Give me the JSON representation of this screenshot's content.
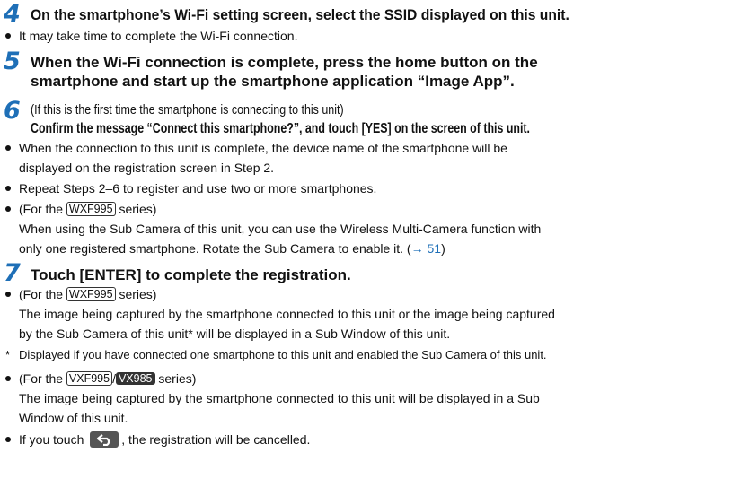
{
  "step4": {
    "number": "4",
    "text": "On the smartphone’s Wi-Fi setting screen, select the SSID displayed on this unit.",
    "bullet": "It may take time to complete the Wi-Fi connection."
  },
  "step5": {
    "number": "5",
    "line1": "When the Wi-Fi connection is complete, press the home button on the",
    "line2": "smartphone and start up the smartphone application “Image App”."
  },
  "step6": {
    "number": "6",
    "intro": "(If this is the first time the smartphone is connecting to this unit)",
    "bold": "Confirm the message “Connect this smartphone?”, and touch [YES] on the screen of this unit.",
    "bullet1_line1": "When the connection to this unit is complete, the device name of the smartphone will be",
    "bullet1_line2": "displayed on the registration screen in Step 2.",
    "bullet2": "Repeat Steps 2–6 to register and use two or more smartphones.",
    "bullet3_prefix": "(For the",
    "bullet3_badge": "WXF995",
    "bullet3_suffix": "series)",
    "bullet3_line2": "When using the Sub Camera of this unit, you can use the Wireless Multi-Camera function with",
    "bullet3_line3_text": "only one registered smartphone. Rotate the Sub Camera to enable it. (",
    "bullet3_link": "→ 51",
    "bullet3_close": ")"
  },
  "step7": {
    "number": "7",
    "text": "Touch [ENTER] to complete the registration.",
    "bullet1_prefix": "(For the",
    "bullet1_badge": "WXF995",
    "bullet1_suffix": "series)",
    "bullet1_line2": "The image being captured by the smartphone connected to this unit or the image being captured",
    "bullet1_line3": "by the Sub Camera of this unit* will be displayed in a Sub Window of this unit.",
    "footnote_star": "*",
    "footnote": "Displayed if you have connected one smartphone to this unit and enabled the Sub Camera of this unit.",
    "bullet2_prefix": "(For the",
    "bullet2_badge1": "VXF995",
    "bullet2_sep": "/",
    "bullet2_badge2": "VX985",
    "bullet2_suffix": "series)",
    "bullet2_line2": "The image being captured by the smartphone connected to this unit will be displayed in a Sub",
    "bullet2_line3": "Window of this unit.",
    "bullet3_prefix": "If you touch",
    "bullet3_icon": "back-arrow-icon",
    "bullet3_suffix": ", the registration will be cancelled."
  },
  "colors": {
    "step_number": "#1e6fb7",
    "link": "#1e6fb7",
    "text": "#111111"
  }
}
